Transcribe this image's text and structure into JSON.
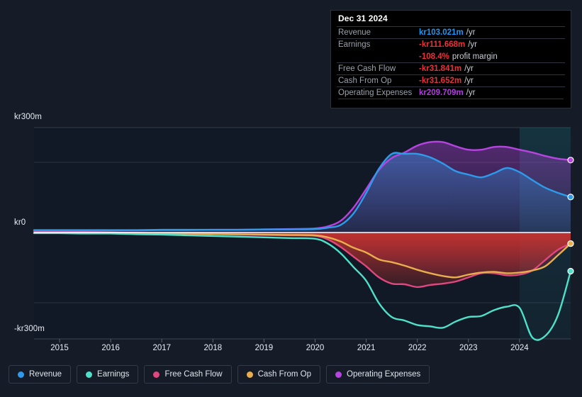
{
  "tooltip": {
    "title": "Dec 31 2024",
    "rows": [
      {
        "label": "Revenue",
        "value": "kr103.021m",
        "unit": "/yr",
        "color": "#2196f3"
      },
      {
        "label": "Earnings",
        "value": "-kr111.668m",
        "unit": "/yr",
        "color": "#e8333a"
      },
      {
        "label": "",
        "value": "-108.4%",
        "unit": "profit margin",
        "color": "#e8333a"
      },
      {
        "label": "Free Cash Flow",
        "value": "-kr31.841m",
        "unit": "/yr",
        "color": "#e8333a"
      },
      {
        "label": "Cash From Op",
        "value": "-kr31.652m",
        "unit": "/yr",
        "color": "#e8333a"
      },
      {
        "label": "Operating Expenses",
        "value": "kr209.709m",
        "unit": "/yr",
        "color": "#b03ddd"
      }
    ]
  },
  "legend": {
    "items": [
      {
        "label": "Revenue",
        "color": "#2e9bea"
      },
      {
        "label": "Earnings",
        "color": "#4ee0c8"
      },
      {
        "label": "Free Cash Flow",
        "color": "#e0477f"
      },
      {
        "label": "Cash From Op",
        "color": "#e8ae4e"
      },
      {
        "label": "Operating Expenses",
        "color": "#b744e0"
      }
    ]
  },
  "axes": {
    "y_labels": [
      "kr300m",
      "kr0",
      "-kr300m"
    ],
    "x_labels": [
      "2015",
      "2016",
      "2017",
      "2018",
      "2019",
      "2020",
      "2021",
      "2022",
      "2023",
      "2024"
    ]
  },
  "chart_data": {
    "type": "line",
    "title": "",
    "xlabel": "",
    "ylabel": "",
    "ylim": [
      -300,
      300
    ],
    "y_unit": "kr millions",
    "grid": true,
    "legend_position": "bottom",
    "x": [
      2014.5,
      2015,
      2015.5,
      2016,
      2016.5,
      2017,
      2017.5,
      2018,
      2018.5,
      2019,
      2019.5,
      2020,
      2020.25,
      2020.5,
      2020.75,
      2021,
      2021.25,
      2021.5,
      2021.75,
      2022,
      2022.25,
      2022.5,
      2022.75,
      2023,
      2023.25,
      2023.5,
      2023.75,
      2024,
      2024.25,
      2024.5,
      2024.75,
      2025
    ],
    "series": [
      {
        "name": "Revenue",
        "color": "#2e9bea",
        "values": [
          7,
          7,
          7,
          7,
          7,
          8,
          8,
          8,
          8,
          9,
          9,
          10,
          14,
          22,
          55,
          115,
          185,
          228,
          228,
          228,
          218,
          200,
          178,
          168,
          160,
          172,
          187,
          175,
          152,
          130,
          115,
          103
        ]
      },
      {
        "name": "Earnings",
        "color": "#4ee0c8",
        "values": [
          -2,
          -2,
          -3,
          -3,
          -5,
          -6,
          -8,
          -10,
          -12,
          -14,
          -16,
          -18,
          -32,
          -60,
          -100,
          -140,
          -205,
          -245,
          -255,
          -268,
          -272,
          -276,
          -258,
          -245,
          -242,
          -225,
          -215,
          -218,
          -330,
          -300,
          -240,
          -112
        ]
      },
      {
        "name": "Free Cash Flow",
        "color": "#e0477f",
        "values": [
          0,
          0,
          0,
          -1,
          -2,
          -3,
          -4,
          -5,
          -6,
          -7,
          -8,
          -10,
          -20,
          -42,
          -70,
          -98,
          -130,
          -148,
          -150,
          -158,
          -152,
          -148,
          -142,
          -130,
          -118,
          -118,
          -124,
          -122,
          -110,
          -80,
          -50,
          -32
        ]
      },
      {
        "name": "Cash From Op",
        "color": "#e8ae4e",
        "values": [
          0,
          0,
          0,
          0,
          -1,
          -2,
          -3,
          -4,
          -5,
          -6,
          -7,
          -8,
          -14,
          -26,
          -44,
          -58,
          -78,
          -86,
          -96,
          -108,
          -118,
          -126,
          -130,
          -122,
          -116,
          -114,
          -118,
          -116,
          -110,
          -98,
          -66,
          -32
        ]
      },
      {
        "name": "Operating Expenses",
        "color": "#b744e0",
        "values": [
          5,
          5,
          5,
          6,
          6,
          7,
          7,
          8,
          8,
          9,
          10,
          12,
          18,
          34,
          72,
          126,
          182,
          216,
          232,
          252,
          262,
          262,
          250,
          240,
          240,
          248,
          248,
          240,
          232,
          222,
          214,
          210
        ]
      }
    ]
  }
}
